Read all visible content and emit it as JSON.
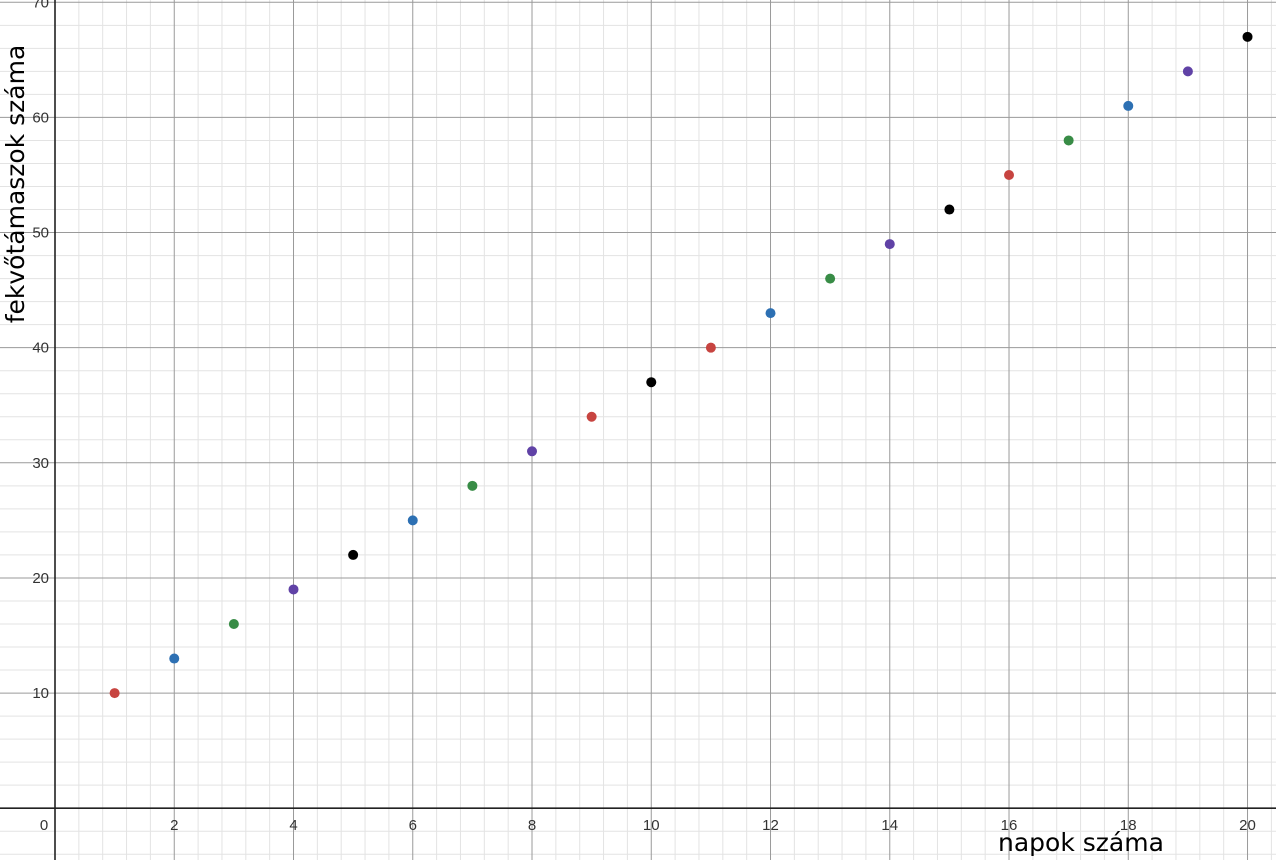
{
  "chart_data": {
    "type": "scatter",
    "title": "",
    "xlabel": "napok száma",
    "ylabel": "fekvőtámaszok száma",
    "xlim": [
      0,
      21.4
    ],
    "ylim": [
      -4.5,
      70.2
    ],
    "x_ticks": [
      {
        "value": 0,
        "label": "0"
      },
      {
        "value": 2,
        "label": "2"
      },
      {
        "value": 4,
        "label": "4"
      },
      {
        "value": 6,
        "label": "6"
      },
      {
        "value": 8,
        "label": "8"
      },
      {
        "value": 10,
        "label": "10"
      },
      {
        "value": 12,
        "label": "12"
      },
      {
        "value": 14,
        "label": "14"
      },
      {
        "value": 16,
        "label": "16"
      },
      {
        "value": 18,
        "label": "18"
      },
      {
        "value": 20,
        "label": "20"
      }
    ],
    "y_ticks": [
      {
        "value": 10,
        "label": "10"
      },
      {
        "value": 20,
        "label": "20"
      },
      {
        "value": 30,
        "label": "30"
      },
      {
        "value": 40,
        "label": "40"
      },
      {
        "value": 50,
        "label": "50"
      },
      {
        "value": 60,
        "label": "60"
      },
      {
        "value": 70,
        "label": "70"
      }
    ],
    "grid": true,
    "minor_grid": true,
    "legend": false,
    "colors": {
      "red": "#c74440",
      "blue": "#2d70b3",
      "green": "#388c46",
      "purple": "#6042a6",
      "black": "#000000",
      "major_grid": "#9a9a9a",
      "minor_grid": "#e3e3e3",
      "axis": "#222222"
    },
    "points": [
      {
        "x": 1,
        "y": 10,
        "color": "red"
      },
      {
        "x": 2,
        "y": 13,
        "color": "blue"
      },
      {
        "x": 3,
        "y": 16,
        "color": "green"
      },
      {
        "x": 4,
        "y": 19,
        "color": "purple"
      },
      {
        "x": 5,
        "y": 22,
        "color": "black"
      },
      {
        "x": 6,
        "y": 25,
        "color": "blue"
      },
      {
        "x": 7,
        "y": 28,
        "color": "green"
      },
      {
        "x": 8,
        "y": 31,
        "color": "purple"
      },
      {
        "x": 9,
        "y": 34,
        "color": "red"
      },
      {
        "x": 10,
        "y": 37,
        "color": "black"
      },
      {
        "x": 11,
        "y": 40,
        "color": "red"
      },
      {
        "x": 12,
        "y": 43,
        "color": "blue"
      },
      {
        "x": 13,
        "y": 46,
        "color": "green"
      },
      {
        "x": 14,
        "y": 49,
        "color": "purple"
      },
      {
        "x": 15,
        "y": 52,
        "color": "black"
      },
      {
        "x": 16,
        "y": 55,
        "color": "red"
      },
      {
        "x": 17,
        "y": 58,
        "color": "green"
      },
      {
        "x": 18,
        "y": 61,
        "color": "blue"
      },
      {
        "x": 19,
        "y": 64,
        "color": "purple"
      },
      {
        "x": 20,
        "y": 67,
        "color": "black"
      }
    ]
  }
}
